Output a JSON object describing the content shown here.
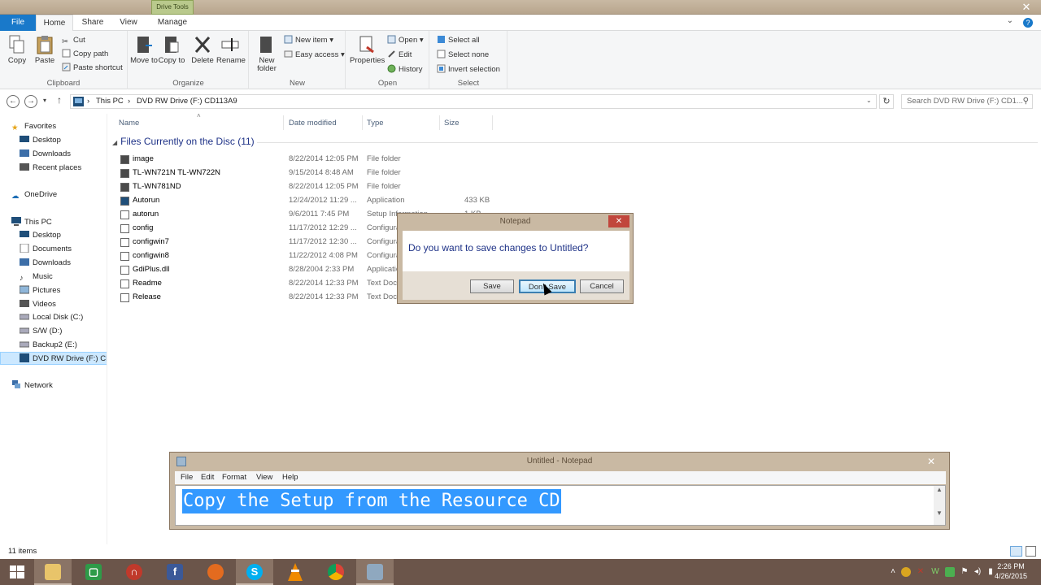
{
  "window": {
    "drive_tools_label": "Drive Tools",
    "close_glyph": "✕"
  },
  "ribbon_tabs": {
    "file": "File",
    "home": "Home",
    "share": "Share",
    "view": "View",
    "manage": "Manage"
  },
  "ribbon": {
    "clipboard": {
      "label": "Clipboard",
      "copy": "Copy",
      "paste": "Paste",
      "cut": "Cut",
      "copy_path": "Copy path",
      "paste_shortcut": "Paste shortcut"
    },
    "organize": {
      "label": "Organize",
      "move_to": "Move to",
      "copy_to": "Copy to",
      "delete": "Delete",
      "rename": "Rename"
    },
    "new": {
      "label": "New",
      "new_folder": "New folder",
      "new_item": "New item",
      "easy_access": "Easy access"
    },
    "open": {
      "label": "Open",
      "properties": "Properties",
      "open": "Open",
      "edit": "Edit",
      "history": "History"
    },
    "select": {
      "label": "Select",
      "select_all": "Select all",
      "select_none": "Select none",
      "invert_selection": "Invert selection"
    }
  },
  "address": {
    "this_pc": "This PC",
    "drive": "DVD RW Drive (F:) CD113A9",
    "search_placeholder": "Search DVD RW Drive (F:) CD1..."
  },
  "nav_pane": {
    "favorites": "Favorites",
    "desktop": "Desktop",
    "downloads": "Downloads",
    "recent": "Recent places",
    "onedrive": "OneDrive",
    "this_pc": "This PC",
    "pc_desktop": "Desktop",
    "documents": "Documents",
    "pc_downloads": "Downloads",
    "music": "Music",
    "pictures": "Pictures",
    "videos": "Videos",
    "local_disk": "Local Disk (C:)",
    "sw": "S/W (D:)",
    "backup2": "Backup2 (E:)",
    "dvd": "DVD RW Drive (F:) CD",
    "network": "Network"
  },
  "columns": {
    "name": "Name",
    "date": "Date modified",
    "type": "Type",
    "size": "Size"
  },
  "group_header": "Files Currently on the Disc (11)",
  "files": [
    {
      "name": "image",
      "date": "8/22/2014 12:05 PM",
      "type": "File folder",
      "size": ""
    },
    {
      "name": "TL-WN721N TL-WN722N",
      "date": "9/15/2014 8:48 AM",
      "type": "File folder",
      "size": ""
    },
    {
      "name": "TL-WN781ND",
      "date": "8/22/2014 12:05 PM",
      "type": "File folder",
      "size": ""
    },
    {
      "name": "Autorun",
      "date": "12/24/2012 11:29 ...",
      "type": "Application",
      "size": "433 KB"
    },
    {
      "name": "autorun",
      "date": "9/6/2011 7:45 PM",
      "type": "Setup Information",
      "size": "1 KB"
    },
    {
      "name": "config",
      "date": "11/17/2012 12:29 ...",
      "type": "Configuration",
      "size": ""
    },
    {
      "name": "configwin7",
      "date": "11/17/2012 12:30 ...",
      "type": "Configuration",
      "size": ""
    },
    {
      "name": "configwin8",
      "date": "11/22/2012 4:08 PM",
      "type": "Configuration",
      "size": ""
    },
    {
      "name": "GdiPlus.dll",
      "date": "8/28/2004 2:33 PM",
      "type": "Application",
      "size": ""
    },
    {
      "name": "Readme",
      "date": "8/22/2014 12:33 PM",
      "type": "Text Document",
      "size": ""
    },
    {
      "name": "Release",
      "date": "8/22/2014 12:33 PM",
      "type": "Text Document",
      "size": ""
    }
  ],
  "status": {
    "count": "11 items"
  },
  "dialog": {
    "title": "Notepad",
    "question": "Do you want to save changes to Untitled?",
    "save": "Save",
    "dont_save": "Don't Save",
    "cancel": "Cancel"
  },
  "notepad": {
    "title": "Untitled - Notepad",
    "menu": [
      "File",
      "Edit",
      "Format",
      "View",
      "Help"
    ],
    "text": "Copy the Setup from the Resource CD"
  },
  "taskbar": {
    "clock_time": "2:26 PM",
    "clock_date": "4/26/2015"
  },
  "colors": {
    "accent": "#1979ca",
    "selection": "#3399ff",
    "taskbar": "#6b554a",
    "window_frame": "#c9b9a3"
  }
}
